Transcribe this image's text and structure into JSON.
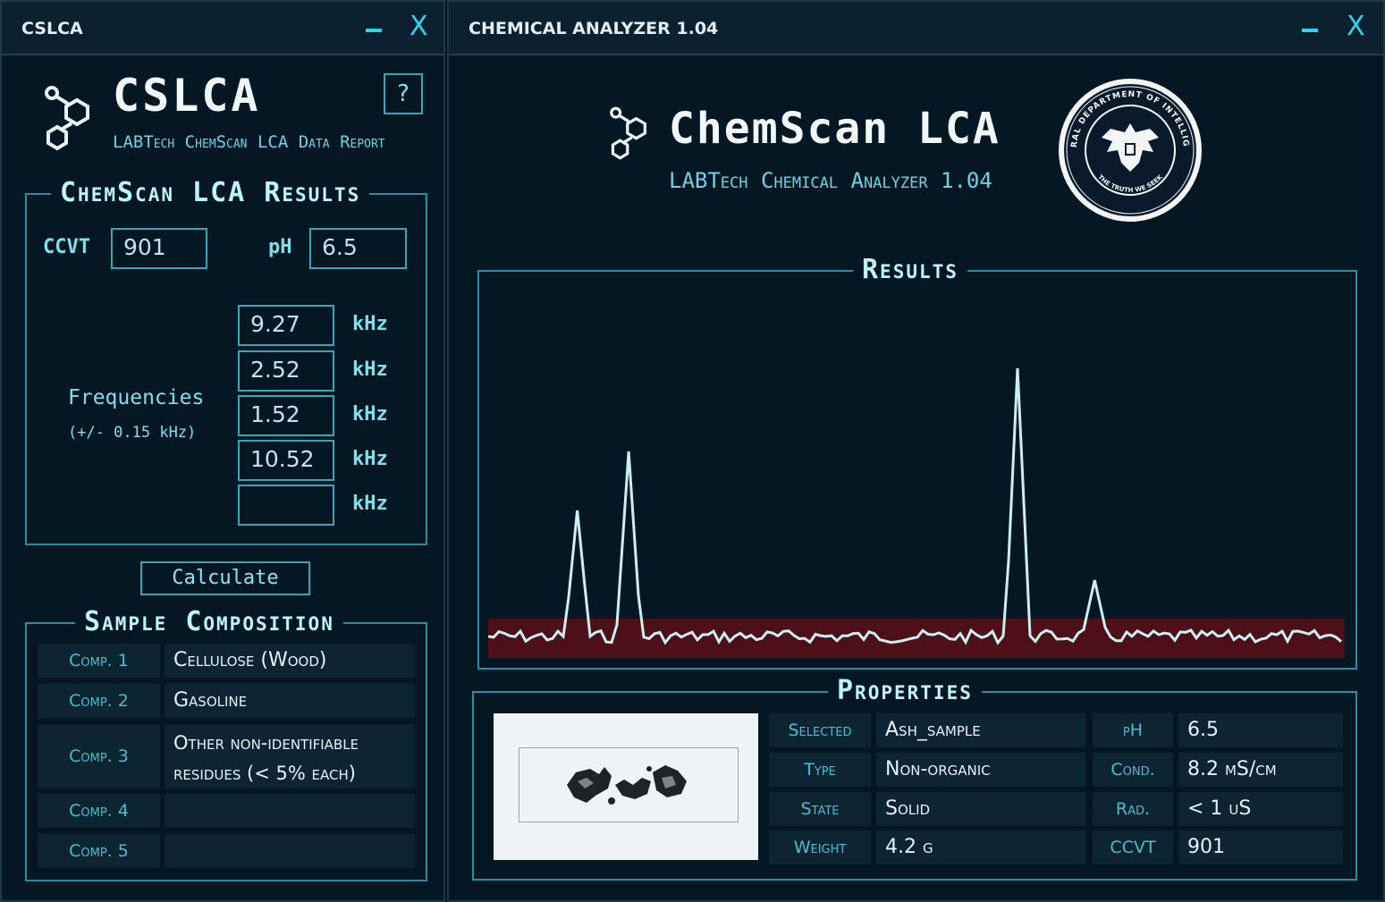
{
  "left_window": {
    "title": "CSLCA",
    "minimize_glyph": "–",
    "close_glyph": "X",
    "logo_text": "CSLCA",
    "subtitle": "LABTech ChemScan LCA Data Report",
    "help_label": "?",
    "results_legend": "ChemScan LCA Results",
    "ccvt_label": "CCVT",
    "ccvt_value": "901",
    "ph_label": "pH",
    "ph_value": "6.5",
    "frequencies_label": "Frequencies",
    "frequencies_tolerance": "(+/- 0.15 kHz)",
    "frequencies": [
      {
        "value": "9.27",
        "unit": "kHz"
      },
      {
        "value": "2.52",
        "unit": "kHz"
      },
      {
        "value": "1.52",
        "unit": "kHz"
      },
      {
        "value": "10.52",
        "unit": "kHz"
      },
      {
        "value": "",
        "unit": "kHz"
      }
    ],
    "calculate_label": "Calculate",
    "composition_legend": "Sample Composition",
    "composition": [
      {
        "label": "Comp. 1",
        "value": "Cellulose (Wood)"
      },
      {
        "label": "Comp. 2",
        "value": "Gasoline"
      },
      {
        "label": "Comp. 3",
        "value": "Other non-identifiable residues (< 5% each)"
      },
      {
        "label": "Comp. 4",
        "value": ""
      },
      {
        "label": "Comp. 5",
        "value": ""
      }
    ]
  },
  "right_window": {
    "title": "CHEMICAL ANALYZER 1.04",
    "minimize_glyph": "–",
    "close_glyph": "X",
    "brand_title": "ChemScan LCA",
    "brand_subtitle": "LABTech Chemical Analyzer 1.04",
    "seal_text": "FEDERAL DEPARTMENT OF INTELLIGENCE",
    "seal_motto": "THE TRUTH WE SEEK",
    "results_legend": "Results",
    "properties_legend": "Properties",
    "properties": [
      {
        "label": "Selected",
        "value": "Ash_sample",
        "label2": "pH",
        "value2": "6.5"
      },
      {
        "label": "Type",
        "value": "Non-organic",
        "label2": "Cond.",
        "value2": "8.2 mS/cm"
      },
      {
        "label": "State",
        "value": "Solid",
        "label2": "Rad.",
        "value2": "< 1 uS"
      },
      {
        "label": "Weight",
        "value": "4.2 g",
        "label2": "CCVT",
        "value2": "901"
      }
    ]
  },
  "chart_data": {
    "type": "line",
    "title": "Results",
    "peaks": [
      {
        "position": 0.104,
        "height": 0.47
      },
      {
        "position": 0.164,
        "height": 0.69
      },
      {
        "position": 0.618,
        "height": 1.0
      },
      {
        "position": 0.708,
        "height": 0.21
      }
    ],
    "noise_band_color": "#5a0f18",
    "line_color": "#cdeff2"
  },
  "colors": {
    "accent": "#2fd6e6",
    "background": "#051722",
    "panel": "#0d2432",
    "border": "#2a8ea0"
  }
}
